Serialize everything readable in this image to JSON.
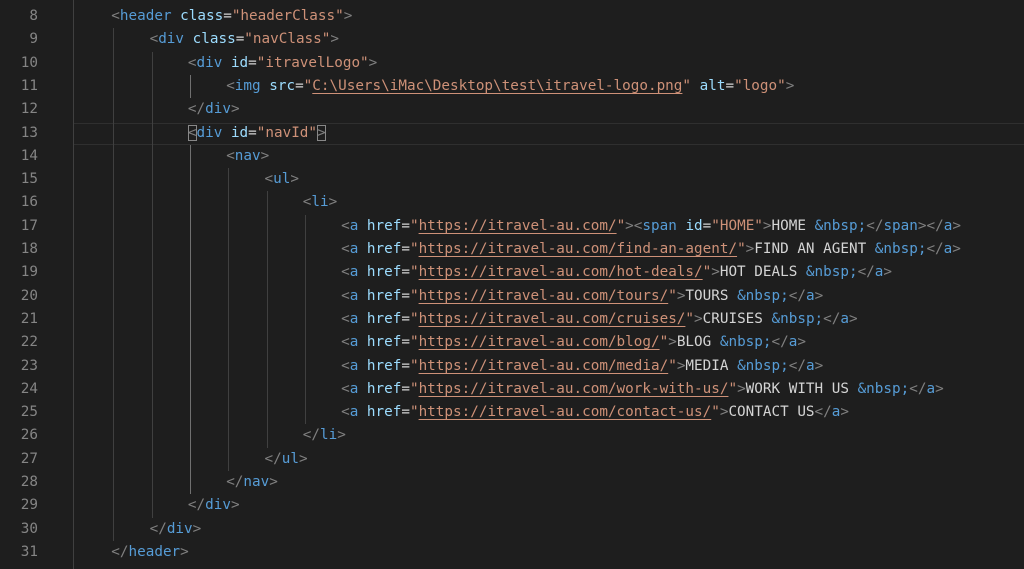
{
  "editor": {
    "lines": [
      {
        "n": "8",
        "indent": 1,
        "tokens": [
          [
            "p",
            "<"
          ],
          [
            "t",
            "header"
          ],
          [
            "x",
            " "
          ],
          [
            "a",
            "class"
          ],
          [
            "x",
            "="
          ],
          [
            "s",
            "\"headerClass\""
          ],
          [
            "p",
            ">"
          ]
        ]
      },
      {
        "n": "9",
        "indent": 2,
        "tokens": [
          [
            "p",
            "<"
          ],
          [
            "t",
            "div"
          ],
          [
            "x",
            " "
          ],
          [
            "a",
            "class"
          ],
          [
            "x",
            "="
          ],
          [
            "s",
            "\"navClass\""
          ],
          [
            "p",
            ">"
          ]
        ]
      },
      {
        "n": "10",
        "indent": 3,
        "tokens": [
          [
            "p",
            "<"
          ],
          [
            "t",
            "div"
          ],
          [
            "x",
            " "
          ],
          [
            "a",
            "id"
          ],
          [
            "x",
            "="
          ],
          [
            "s",
            "\"itravelLogo\""
          ],
          [
            "p",
            ">"
          ]
        ]
      },
      {
        "n": "11",
        "indent": 4,
        "tokens": [
          [
            "p",
            "<"
          ],
          [
            "t",
            "img"
          ],
          [
            "x",
            " "
          ],
          [
            "a",
            "src"
          ],
          [
            "x",
            "="
          ],
          [
            "s",
            "\""
          ],
          [
            "l",
            "C:\\Users\\iMac\\Desktop\\test\\itravel-logo.png"
          ],
          [
            "s",
            "\""
          ],
          [
            "x",
            " "
          ],
          [
            "a",
            "alt"
          ],
          [
            "x",
            "="
          ],
          [
            "s",
            "\"logo\""
          ],
          [
            "p",
            ">"
          ]
        ]
      },
      {
        "n": "12",
        "indent": 3,
        "tokens": [
          [
            "p",
            "</"
          ],
          [
            "t",
            "div"
          ],
          [
            "p",
            ">"
          ]
        ]
      },
      {
        "n": "13",
        "indent": 3,
        "current": true,
        "tokens": [
          [
            "pb",
            "<"
          ],
          [
            "t",
            "div"
          ],
          [
            "x",
            " "
          ],
          [
            "a",
            "id"
          ],
          [
            "x",
            "="
          ],
          [
            "s",
            "\"navId\""
          ],
          [
            "pb",
            ">"
          ]
        ]
      },
      {
        "n": "14",
        "indent": 4,
        "tokens": [
          [
            "p",
            "<"
          ],
          [
            "t",
            "nav"
          ],
          [
            "p",
            ">"
          ]
        ]
      },
      {
        "n": "15",
        "indent": 5,
        "tokens": [
          [
            "p",
            "<"
          ],
          [
            "t",
            "ul"
          ],
          [
            "p",
            ">"
          ]
        ]
      },
      {
        "n": "16",
        "indent": 6,
        "tokens": [
          [
            "p",
            "<"
          ],
          [
            "t",
            "li"
          ],
          [
            "p",
            ">"
          ]
        ]
      },
      {
        "n": "17",
        "indent": 7,
        "tokens": [
          [
            "p",
            "<"
          ],
          [
            "t",
            "a"
          ],
          [
            "x",
            " "
          ],
          [
            "a",
            "href"
          ],
          [
            "x",
            "="
          ],
          [
            "s",
            "\""
          ],
          [
            "l",
            "https://itravel-au.com/"
          ],
          [
            "s",
            "\""
          ],
          [
            "p",
            "><"
          ],
          [
            "t",
            "span"
          ],
          [
            "x",
            " "
          ],
          [
            "a",
            "id"
          ],
          [
            "x",
            "="
          ],
          [
            "s",
            "\"HOME\""
          ],
          [
            "p",
            ">"
          ],
          [
            "x",
            "HOME "
          ],
          [
            "e",
            "&nbsp;"
          ],
          [
            "p",
            "</"
          ],
          [
            "t",
            "span"
          ],
          [
            "p",
            "></"
          ],
          [
            "t",
            "a"
          ],
          [
            "p",
            ">"
          ]
        ]
      },
      {
        "n": "18",
        "indent": 7,
        "tokens": [
          [
            "p",
            "<"
          ],
          [
            "t",
            "a"
          ],
          [
            "x",
            " "
          ],
          [
            "a",
            "href"
          ],
          [
            "x",
            "="
          ],
          [
            "s",
            "\""
          ],
          [
            "l",
            "https://itravel-au.com/find-an-agent/"
          ],
          [
            "s",
            "\""
          ],
          [
            "p",
            ">"
          ],
          [
            "x",
            "FIND AN AGENT "
          ],
          [
            "e",
            "&nbsp;"
          ],
          [
            "p",
            "</"
          ],
          [
            "t",
            "a"
          ],
          [
            "p",
            ">"
          ]
        ]
      },
      {
        "n": "19",
        "indent": 7,
        "tokens": [
          [
            "p",
            "<"
          ],
          [
            "t",
            "a"
          ],
          [
            "x",
            " "
          ],
          [
            "a",
            "href"
          ],
          [
            "x",
            "="
          ],
          [
            "s",
            "\""
          ],
          [
            "l",
            "https://itravel-au.com/hot-deals/"
          ],
          [
            "s",
            "\""
          ],
          [
            "p",
            ">"
          ],
          [
            "x",
            "HOT DEALS "
          ],
          [
            "e",
            "&nbsp;"
          ],
          [
            "p",
            "</"
          ],
          [
            "t",
            "a"
          ],
          [
            "p",
            ">"
          ]
        ]
      },
      {
        "n": "20",
        "indent": 7,
        "tokens": [
          [
            "p",
            "<"
          ],
          [
            "t",
            "a"
          ],
          [
            "x",
            " "
          ],
          [
            "a",
            "href"
          ],
          [
            "x",
            "="
          ],
          [
            "s",
            "\""
          ],
          [
            "l",
            "https://itravel-au.com/tours/"
          ],
          [
            "s",
            "\""
          ],
          [
            "p",
            ">"
          ],
          [
            "x",
            "TOURS "
          ],
          [
            "e",
            "&nbsp;"
          ],
          [
            "p",
            "</"
          ],
          [
            "t",
            "a"
          ],
          [
            "p",
            ">"
          ]
        ]
      },
      {
        "n": "21",
        "indent": 7,
        "tokens": [
          [
            "p",
            "<"
          ],
          [
            "t",
            "a"
          ],
          [
            "x",
            " "
          ],
          [
            "a",
            "href"
          ],
          [
            "x",
            "="
          ],
          [
            "s",
            "\""
          ],
          [
            "l",
            "https://itravel-au.com/cruises/"
          ],
          [
            "s",
            "\""
          ],
          [
            "p",
            ">"
          ],
          [
            "x",
            "CRUISES "
          ],
          [
            "e",
            "&nbsp;"
          ],
          [
            "p",
            "</"
          ],
          [
            "t",
            "a"
          ],
          [
            "p",
            ">"
          ]
        ]
      },
      {
        "n": "22",
        "indent": 7,
        "tokens": [
          [
            "p",
            "<"
          ],
          [
            "t",
            "a"
          ],
          [
            "x",
            " "
          ],
          [
            "a",
            "href"
          ],
          [
            "x",
            "="
          ],
          [
            "s",
            "\""
          ],
          [
            "l",
            "https://itravel-au.com/blog/"
          ],
          [
            "s",
            "\""
          ],
          [
            "p",
            ">"
          ],
          [
            "x",
            "BLOG "
          ],
          [
            "e",
            "&nbsp;"
          ],
          [
            "p",
            "</"
          ],
          [
            "t",
            "a"
          ],
          [
            "p",
            ">"
          ]
        ]
      },
      {
        "n": "23",
        "indent": 7,
        "tokens": [
          [
            "p",
            "<"
          ],
          [
            "t",
            "a"
          ],
          [
            "x",
            " "
          ],
          [
            "a",
            "href"
          ],
          [
            "x",
            "="
          ],
          [
            "s",
            "\""
          ],
          [
            "l",
            "https://itravel-au.com/media/"
          ],
          [
            "s",
            "\""
          ],
          [
            "p",
            ">"
          ],
          [
            "x",
            "MEDIA "
          ],
          [
            "e",
            "&nbsp;"
          ],
          [
            "p",
            "</"
          ],
          [
            "t",
            "a"
          ],
          [
            "p",
            ">"
          ]
        ]
      },
      {
        "n": "24",
        "indent": 7,
        "tokens": [
          [
            "p",
            "<"
          ],
          [
            "t",
            "a"
          ],
          [
            "x",
            " "
          ],
          [
            "a",
            "href"
          ],
          [
            "x",
            "="
          ],
          [
            "s",
            "\""
          ],
          [
            "l",
            "https://itravel-au.com/work-with-us/"
          ],
          [
            "s",
            "\""
          ],
          [
            "p",
            ">"
          ],
          [
            "x",
            "WORK WITH US "
          ],
          [
            "e",
            "&nbsp;"
          ],
          [
            "p",
            "</"
          ],
          [
            "t",
            "a"
          ],
          [
            "p",
            ">"
          ]
        ]
      },
      {
        "n": "25",
        "indent": 7,
        "tokens": [
          [
            "p",
            "<"
          ],
          [
            "t",
            "a"
          ],
          [
            "x",
            " "
          ],
          [
            "a",
            "href"
          ],
          [
            "x",
            "="
          ],
          [
            "s",
            "\""
          ],
          [
            "l",
            "https://itravel-au.com/contact-us/"
          ],
          [
            "s",
            "\""
          ],
          [
            "p",
            ">"
          ],
          [
            "x",
            "CONTACT US"
          ],
          [
            "p",
            "</"
          ],
          [
            "t",
            "a"
          ],
          [
            "p",
            ">"
          ]
        ]
      },
      {
        "n": "26",
        "indent": 6,
        "tokens": [
          [
            "p",
            "</"
          ],
          [
            "t",
            "li"
          ],
          [
            "p",
            ">"
          ]
        ]
      },
      {
        "n": "27",
        "indent": 5,
        "tokens": [
          [
            "p",
            "</"
          ],
          [
            "t",
            "ul"
          ],
          [
            "p",
            ">"
          ]
        ]
      },
      {
        "n": "28",
        "indent": 4,
        "tokens": [
          [
            "p",
            "</"
          ],
          [
            "t",
            "nav"
          ],
          [
            "p",
            ">"
          ]
        ]
      },
      {
        "n": "29",
        "indent": 3,
        "tokens": [
          [
            "p",
            "</"
          ],
          [
            "t",
            "div"
          ],
          [
            "p",
            ">"
          ]
        ]
      },
      {
        "n": "30",
        "indent": 2,
        "tokens": [
          [
            "p",
            "</"
          ],
          [
            "t",
            "div"
          ],
          [
            "p",
            ">"
          ]
        ]
      },
      {
        "n": "31",
        "indent": 1,
        "tokens": [
          [
            "p",
            "</"
          ],
          [
            "t",
            "header"
          ],
          [
            "p",
            ">"
          ]
        ]
      }
    ]
  }
}
